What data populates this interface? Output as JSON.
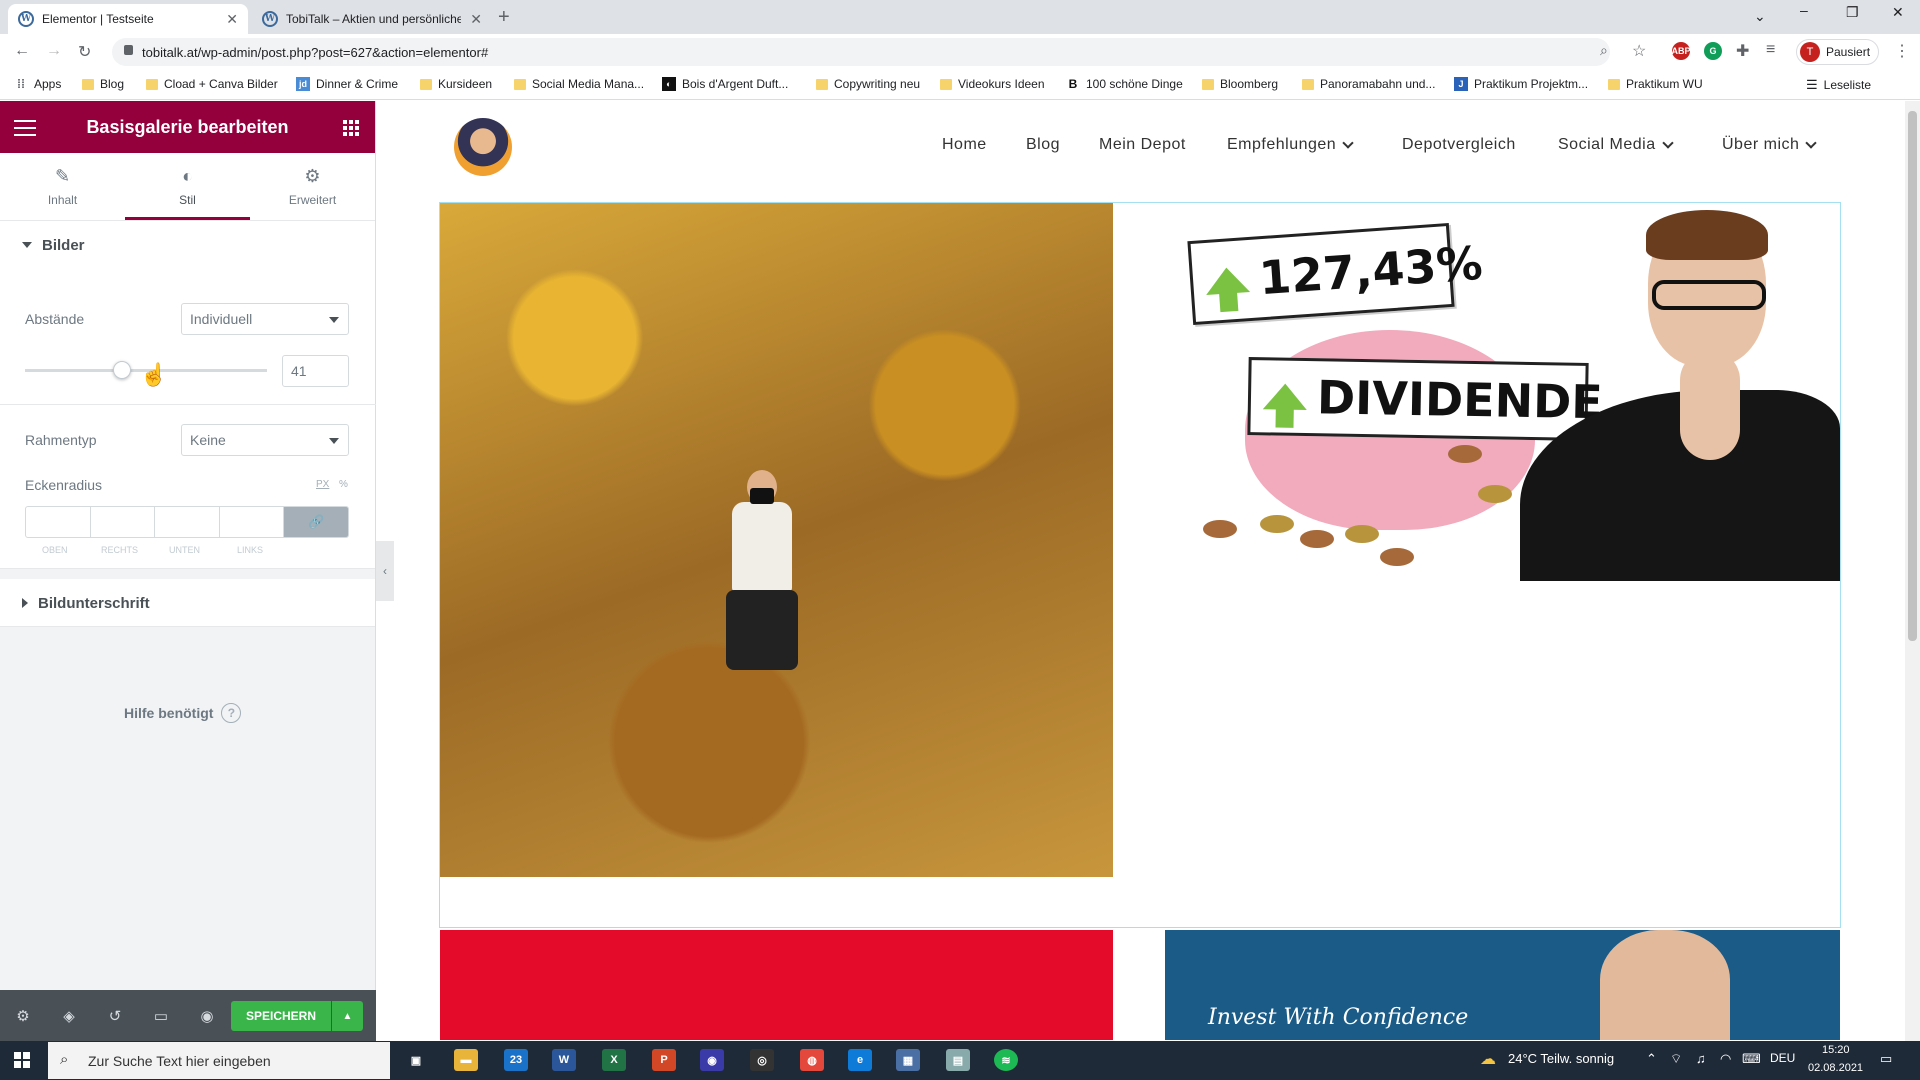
{
  "browser": {
    "tabs": [
      {
        "title": "Elementor | Testseite",
        "active": true
      },
      {
        "title": "TobiTalk – Aktien und persönliche",
        "active": false
      }
    ],
    "url": "tobitalk.at/wp-admin/post.php?post=627&action=elementor#",
    "profile_label": "Pausiert",
    "profile_initial": "T",
    "bookmarks": [
      "Apps",
      "Blog",
      "Cload + Canva Bilder",
      "Dinner & Crime",
      "Kursideen",
      "Social Media Mana...",
      "Bois d'Argent Duft...",
      "Copywriting neu",
      "Videokurs Ideen",
      "100 schöne Dinge",
      "Bloomberg",
      "Panoramabahn und...",
      "Praktikum Projektm...",
      "Praktikum WU"
    ],
    "reading_list": "Leseliste"
  },
  "panel": {
    "title": "Basisgalerie bearbeiten",
    "tabs": [
      {
        "label": "Inhalt",
        "icon": "pencil-icon"
      },
      {
        "label": "Stil",
        "icon": "contrast-icon",
        "active": true
      },
      {
        "label": "Erweitert",
        "icon": "gear-icon"
      }
    ],
    "section_images": "Bilder",
    "spacing_label": "Abstände",
    "spacing_value": "Individuell",
    "slider_value": "41",
    "slider_fraction": 0.41,
    "border_label": "Rahmentyp",
    "border_value": "Keine",
    "radius_label": "Eckenradius",
    "unit_px": "PX",
    "unit_pct": "%",
    "dims": [
      "OBEN",
      "RECHTS",
      "UNTEN",
      "LINKS"
    ],
    "section_caption": "Bildunterschrift",
    "help": "Hilfe benötigt",
    "save": "SPEICHERN"
  },
  "site": {
    "menu": [
      "Home",
      "Blog",
      "Mein Depot",
      "Empfehlungen",
      "Depotvergleich",
      "Social Media",
      "Über mich"
    ],
    "thumb_percent": "127,43%",
    "thumb_word": "DIVIDENDE",
    "invest_text": "Invest With Confidence"
  },
  "taskbar": {
    "search_placeholder": "Zur Suche Text hier eingeben",
    "weather": "24°C  Teilw. sonnig",
    "lang": "DEU",
    "time": "15:20",
    "date": "02.08.2021",
    "mail_badge": "23"
  },
  "colors": {
    "elementor": "#93003c",
    "save": "#39b54a"
  }
}
